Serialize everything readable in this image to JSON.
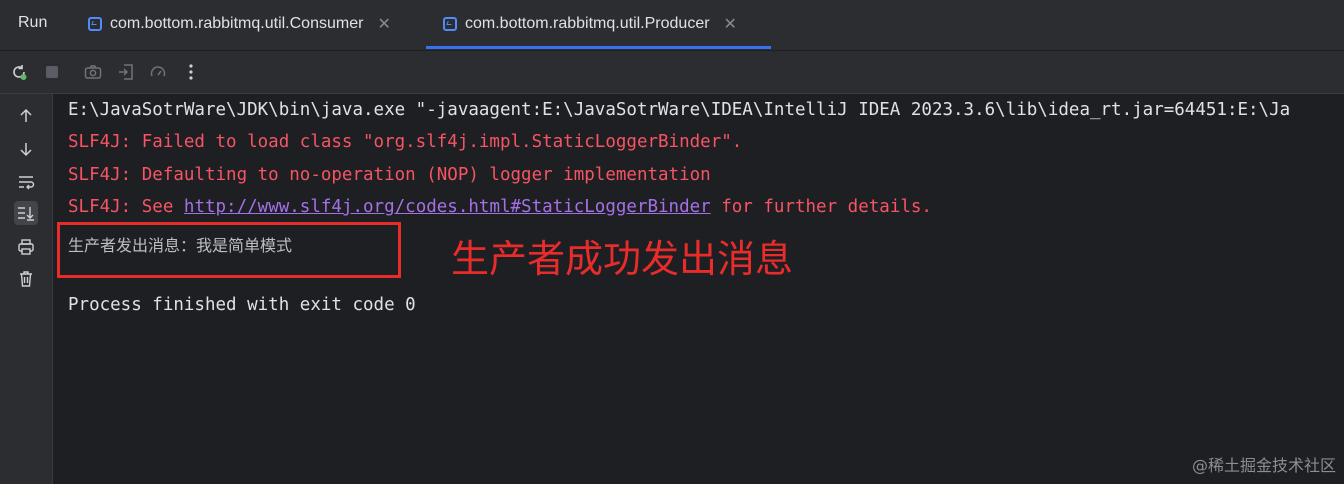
{
  "window": {
    "panel_title": "Run"
  },
  "tabs": [
    {
      "label": "com.bottom.rabbitmq.util.Consumer",
      "active": false
    },
    {
      "label": "com.bottom.rabbitmq.util.Producer",
      "active": true
    }
  ],
  "toolbar": {
    "icons": [
      "rerun-icon",
      "stop-icon",
      "camera-icon",
      "exit-icon",
      "gauge-icon",
      "more-icon"
    ]
  },
  "gutter": {
    "icons": [
      "up-arrow-icon",
      "down-arrow-icon",
      "soft-wrap-icon",
      "scroll-to-end-icon",
      "print-icon",
      "trash-icon"
    ]
  },
  "console": {
    "command_line": "E:\\JavaSotrWare\\JDK\\bin\\java.exe \"-javaagent:E:\\JavaSotrWare\\IDEA\\IntelliJ IDEA 2023.3.6\\lib\\idea_rt.jar=64451:E:\\Ja",
    "slf4j_line1": "SLF4J: Failed to load class \"org.slf4j.impl.StaticLoggerBinder\".",
    "slf4j_line2": "SLF4J: Defaulting to no-operation (NOP) logger implementation",
    "slf4j_line3_prefix": "SLF4J: See ",
    "slf4j_line3_link": "http://www.slf4j.org/codes.html#StaticLoggerBinder",
    "slf4j_line3_suffix": " for further details.",
    "producer_output": "生产者发出消息：我是简单模式",
    "exit_line": "Process finished with exit code 0"
  },
  "annotation": {
    "text": "生产者成功发出消息"
  },
  "watermark": "@稀土掘金技术社区",
  "colors": {
    "background": "#1e1f22",
    "panel": "#2b2d30",
    "error_text": "#f75464",
    "link": "#a571e6",
    "annotation_red": "#e82c2c",
    "accent": "#3574f0"
  }
}
